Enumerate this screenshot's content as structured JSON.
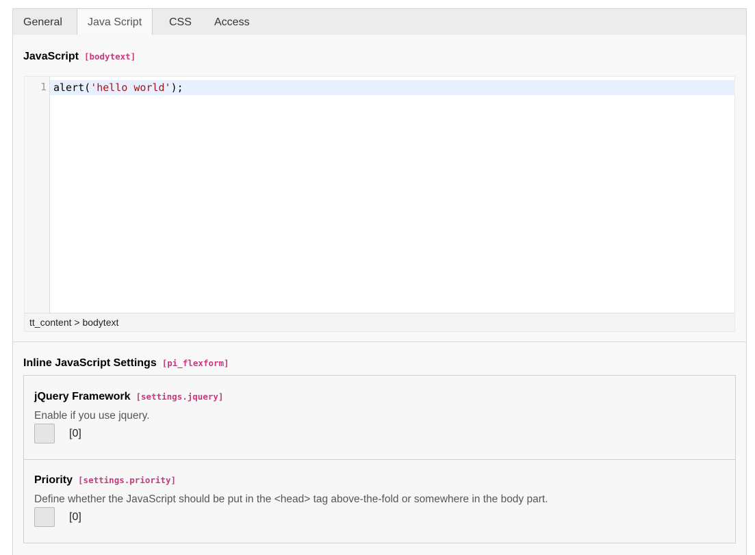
{
  "tabs": [
    {
      "label": "General",
      "active": false
    },
    {
      "label": "Java Script",
      "active": true
    },
    {
      "label": "CSS",
      "active": false
    },
    {
      "label": "Access",
      "active": false
    }
  ],
  "javascript_field": {
    "label": "JavaScript",
    "key": "[bodytext]",
    "editor": {
      "line_number": "1",
      "code": {
        "prefix": "alert(",
        "string": "'hello world'",
        "suffix": ");"
      },
      "status_path": "tt_content > bodytext"
    }
  },
  "inline_settings": {
    "label": "Inline JavaScript Settings",
    "key": "[pi_flexform]",
    "items": [
      {
        "label": "jQuery Framework",
        "key": "[settings.jquery]",
        "description": "Enable if you use jquery.",
        "value": "[0]"
      },
      {
        "label": "Priority",
        "key": "[settings.priority]",
        "description": "Define whether the JavaScript should be put in the <head> tag above-the-fold or somewhere in the body part.",
        "value": "[0]"
      }
    ]
  },
  "colors": {
    "key_accent": "#c63a7e",
    "active_line": "#e8f0fd",
    "code_string": "#a31515"
  }
}
